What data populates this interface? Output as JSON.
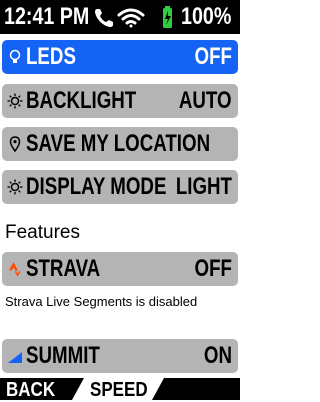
{
  "status_bar": {
    "time": "12:41 PM",
    "battery_percent": "100%",
    "icons": [
      "phone-icon",
      "wifi-icon",
      "battery-charging-icon"
    ]
  },
  "settings": [
    {
      "label": "LEDS",
      "value": "OFF",
      "icon": "bulb-icon",
      "selected": true
    },
    {
      "label": "BACKLIGHT",
      "value": "AUTO",
      "icon": "sun-icon"
    },
    {
      "label": "SAVE MY LOCATION",
      "value": "",
      "icon": "location-pin-icon"
    },
    {
      "label": "DISPLAY MODE",
      "value": "LIGHT",
      "icon": "sun-icon"
    }
  ],
  "features": {
    "title": "Features",
    "strava": {
      "label": "STRAVA",
      "value": "OFF",
      "icon": "strava-icon",
      "note": "Strava Live Segments is disabled"
    },
    "summit": {
      "label": "SUMMIT",
      "value": "ON",
      "icon": "summit-icon"
    }
  },
  "bottom_bar": {
    "back_label": "BACK",
    "speed_label": "SPEED"
  },
  "colors": {
    "accent": "#1463f5",
    "row_bg": "#b4b4b4",
    "strava": "#fc4c02",
    "battery": "#2ecc40"
  }
}
